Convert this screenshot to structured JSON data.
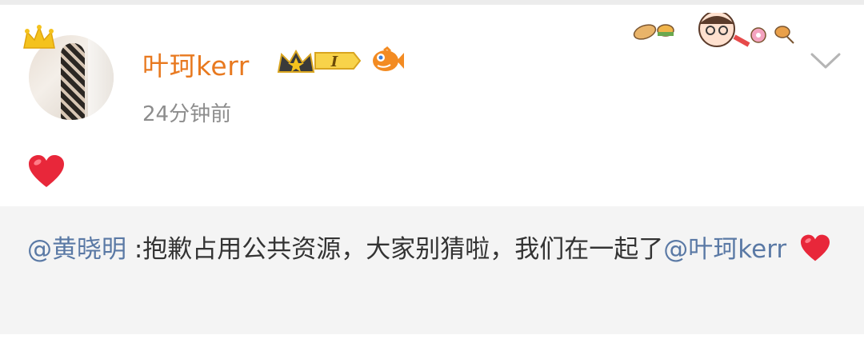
{
  "post": {
    "username": "叶珂kerr",
    "vip_level": "I",
    "timestamp": "24分钟前",
    "content_icon": "red-heart-emoji"
  },
  "repost": {
    "mention_author": "@黄晓明",
    "text": " :抱歉占用公共资源，大家别猜啦，我们在一起了",
    "mention_target": "@叶珂kerr",
    "trailing_icon": "red-heart-emoji"
  },
  "colors": {
    "username": "#e8791f",
    "mention": "#5a79a5",
    "timestamp": "#8d8d8d",
    "repost_bg": "#f4f4f4"
  }
}
